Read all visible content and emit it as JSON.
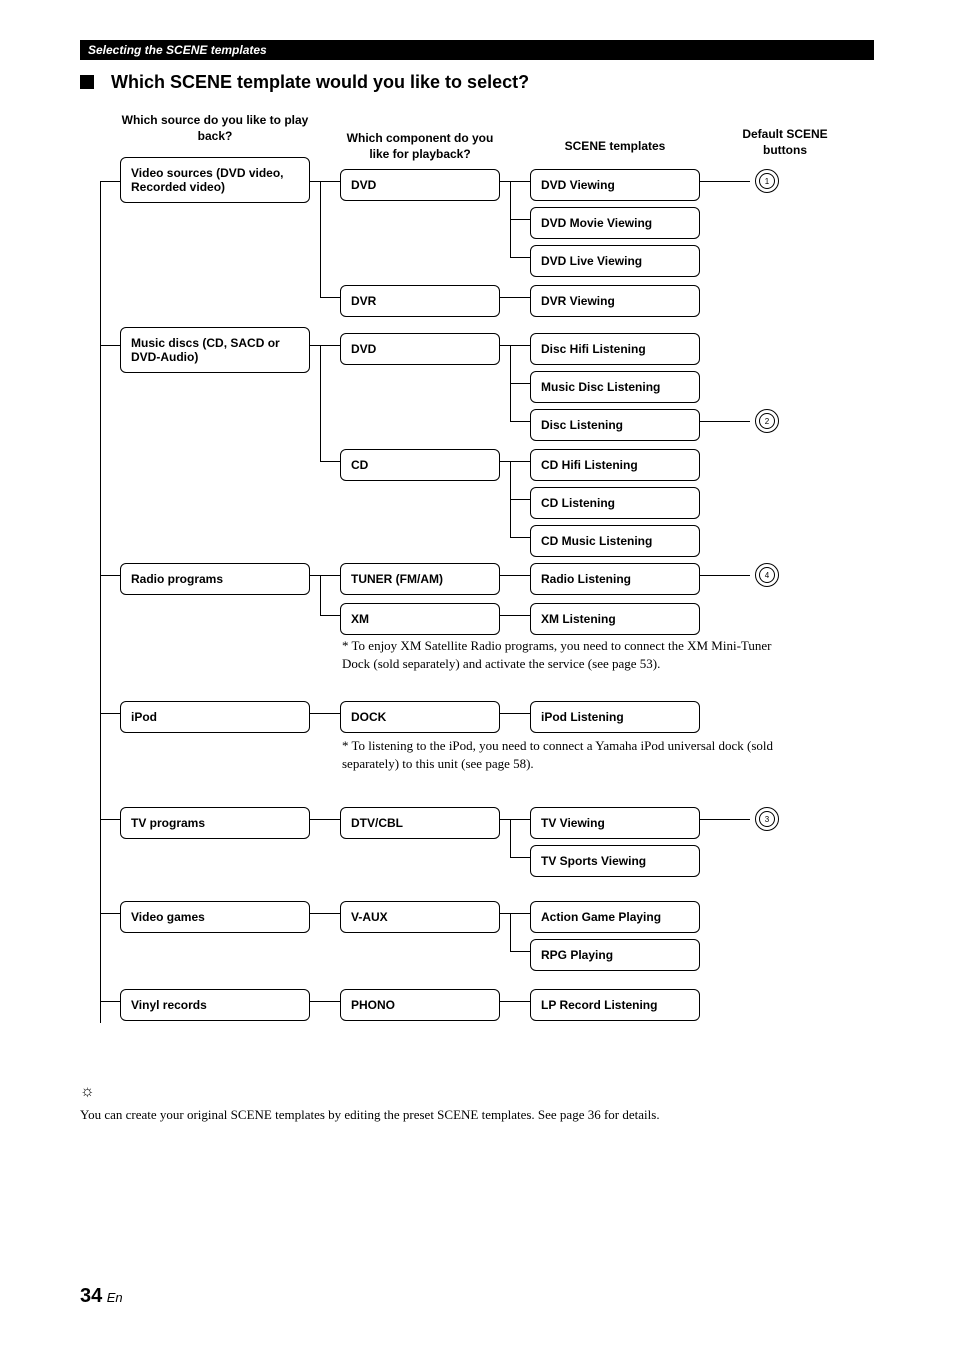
{
  "header": {
    "breadcrumb": "Selecting the SCENE templates"
  },
  "title": "Which SCENE template would you like to select?",
  "col_heads": {
    "source": "Which source do you like to play back?",
    "component": "Which component do you like for playback?",
    "templates": "SCENE templates",
    "buttons": "Default SCENE buttons"
  },
  "src": {
    "video": "Video sources (DVD video, Recorded video)",
    "music": "Music discs (CD, SACD or DVD-Audio)",
    "radio": "Radio programs",
    "ipod": "iPod",
    "tv": "TV programs",
    "games": "Video games",
    "vinyl": "Vinyl records"
  },
  "comp": {
    "dvd": "DVD",
    "dvr": "DVR",
    "dvd2": "DVD",
    "cd": "CD",
    "tuner": "TUNER (FM/AM)",
    "xm": "XM",
    "dock": "DOCK",
    "dtv": "DTV/CBL",
    "vaux": "V-AUX",
    "phono": "PHONO"
  },
  "tmpl": {
    "dvd_view": "DVD Viewing",
    "dvd_movie": "DVD Movie Viewing",
    "dvd_live": "DVD Live Viewing",
    "dvr_view": "DVR Viewing",
    "disc_hifi": "Disc Hifi Listening",
    "music_disc": "Music Disc Listening",
    "disc_listen": "Disc Listening",
    "cd_hifi": "CD Hifi Listening",
    "cd_listen": "CD Listening",
    "cd_music": "CD Music Listening",
    "radio_listen": "Radio Listening",
    "xm_listen": "XM Listening",
    "ipod_listen": "iPod Listening",
    "tv_view": "TV Viewing",
    "tv_sports": "TV Sports Viewing",
    "action_game": "Action Game Playing",
    "rpg": "RPG Playing",
    "lp": "LP Record Listening"
  },
  "btns": {
    "b1": "1",
    "b2": "2",
    "b3": "3",
    "b4": "4"
  },
  "notes": {
    "xm": "*   To enjoy XM Satellite Radio programs, you need to connect the XM Mini-Tuner Dock (sold separately) and activate the service (see page 53).",
    "ipod": "*   To listening to the iPod, you need to connect a Yamaha iPod universal dock (sold separately) to this unit (see page 58)."
  },
  "tip": "You can create your original SCENE templates by editing the preset SCENE templates. See page 36 for details.",
  "page": {
    "num": "34",
    "lang": "En"
  }
}
